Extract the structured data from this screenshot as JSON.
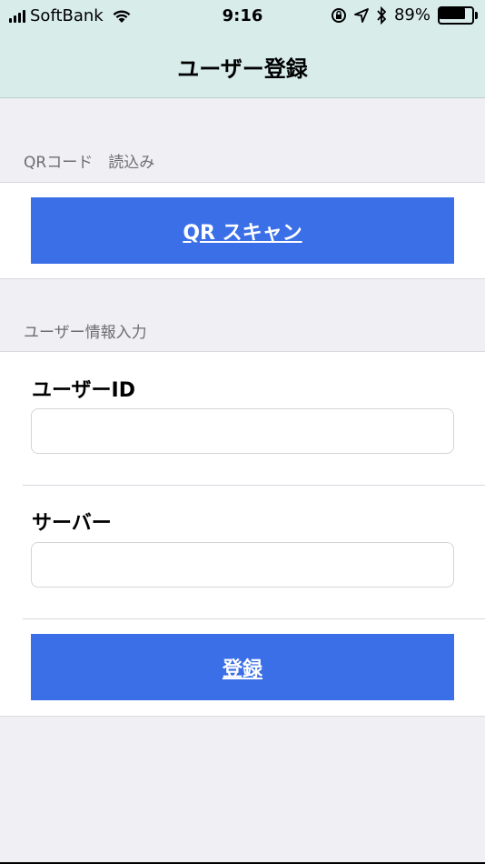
{
  "status_bar": {
    "carrier": "SoftBank",
    "time": "9:16",
    "battery_percent_label": "89%",
    "battery_level": 0.89
  },
  "nav": {
    "title": "ユーザー登録"
  },
  "qr_section": {
    "header": "QRコード　読込み",
    "scan_button_label": "QR スキャン"
  },
  "user_info_section": {
    "header": "ユーザー情報入力",
    "user_id": {
      "label": "ユーザーID",
      "value": "",
      "placeholder": ""
    },
    "server": {
      "label": "サーバー",
      "value": "",
      "placeholder": ""
    },
    "register_button_label": "登録"
  },
  "colors": {
    "nav_background": "#d8ecea",
    "button_blue": "#3a6fe8",
    "page_background": "#efeff4",
    "section_header_text": "#6d6d72"
  },
  "icons": [
    "signal-icon",
    "wifi-icon",
    "orientation-lock-icon",
    "location-icon",
    "bluetooth-icon",
    "battery-icon"
  ]
}
